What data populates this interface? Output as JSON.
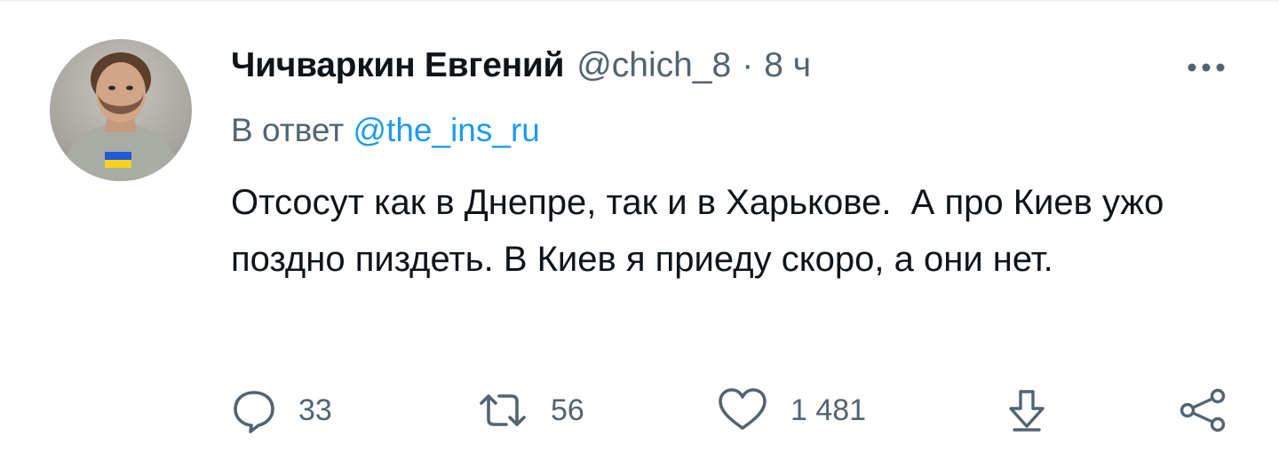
{
  "tweet": {
    "author_name": "Чичваркин Евгений",
    "author_handle": "@chich_8",
    "separator": "·",
    "time_ago": "8 ч",
    "reply_prefix": "В ответ",
    "reply_to": "@the_ins_ru",
    "text": "Отсосут как в Днепре, так и в Харькове.  А про Киев ужо поздно пиздеть. В Киев я приеду скоро, а они нет."
  },
  "actions": {
    "reply_count": "33",
    "retweet_count": "56",
    "like_count": "1 481"
  },
  "icons": {
    "more": "more-horizontal-icon",
    "reply": "reply-bubble-icon",
    "retweet": "retweet-icon",
    "like": "heart-icon",
    "save": "download-arrow-icon",
    "share": "share-icon"
  },
  "colors": {
    "text": "#0f1419",
    "secondary": "#536471",
    "link": "#1d9bf0",
    "flag_blue": "#1f5bd8",
    "flag_yellow": "#f7d21b"
  }
}
